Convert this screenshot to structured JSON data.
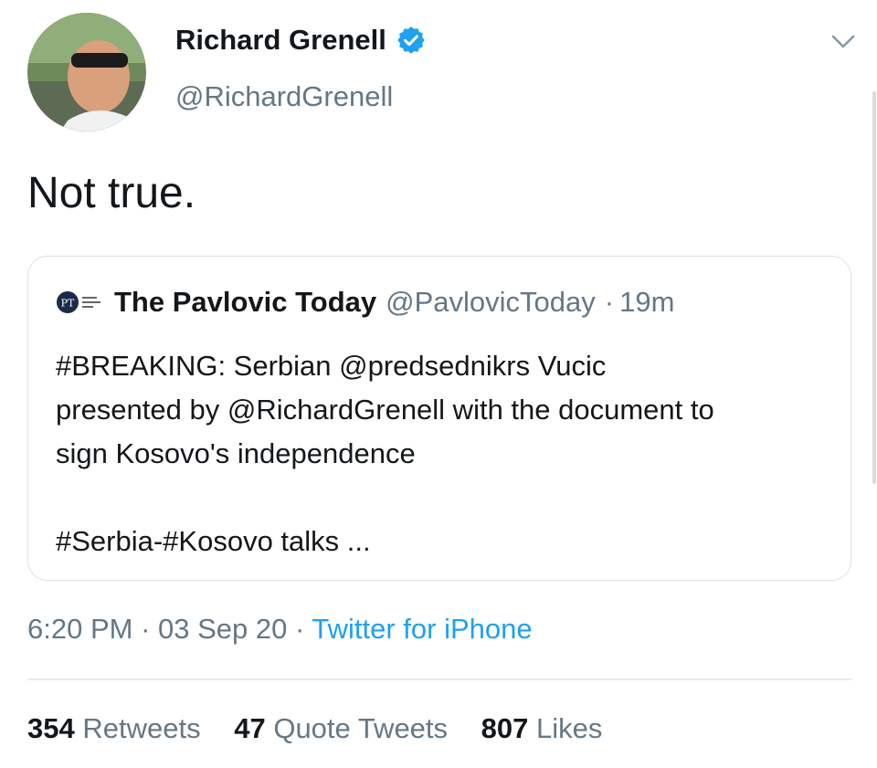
{
  "tweet": {
    "author_name": "Richard Grenell",
    "author_handle": "@RichardGrenell",
    "text": "Not true.",
    "time": "6:20 PM",
    "date": "03 Sep 20",
    "source": "Twitter for iPhone"
  },
  "quoted": {
    "author_name": "The Pavlovic Today",
    "author_handle": "@PavlovicToday",
    "age": "19m",
    "lines": [
      "#BREAKING: Serbian @predsednikrs Vucic",
      "presented by @RichardGrenell with the document to",
      "sign Kosovo's independence",
      "#Serbia-#Kosovo talks ..."
    ]
  },
  "stats": {
    "retweets_count": "354",
    "retweets_label": "Retweets",
    "quote_count": "47",
    "quote_label": "Quote Tweets",
    "likes_count": "807",
    "likes_label": "Likes"
  },
  "colors": {
    "verified": "#1da1f2",
    "link": "#1da1f2",
    "secondary_text": "#657786"
  },
  "icons": [
    "avatar",
    "verified-badge-icon",
    "chevron-down-icon",
    "publication-logo-icon"
  ]
}
